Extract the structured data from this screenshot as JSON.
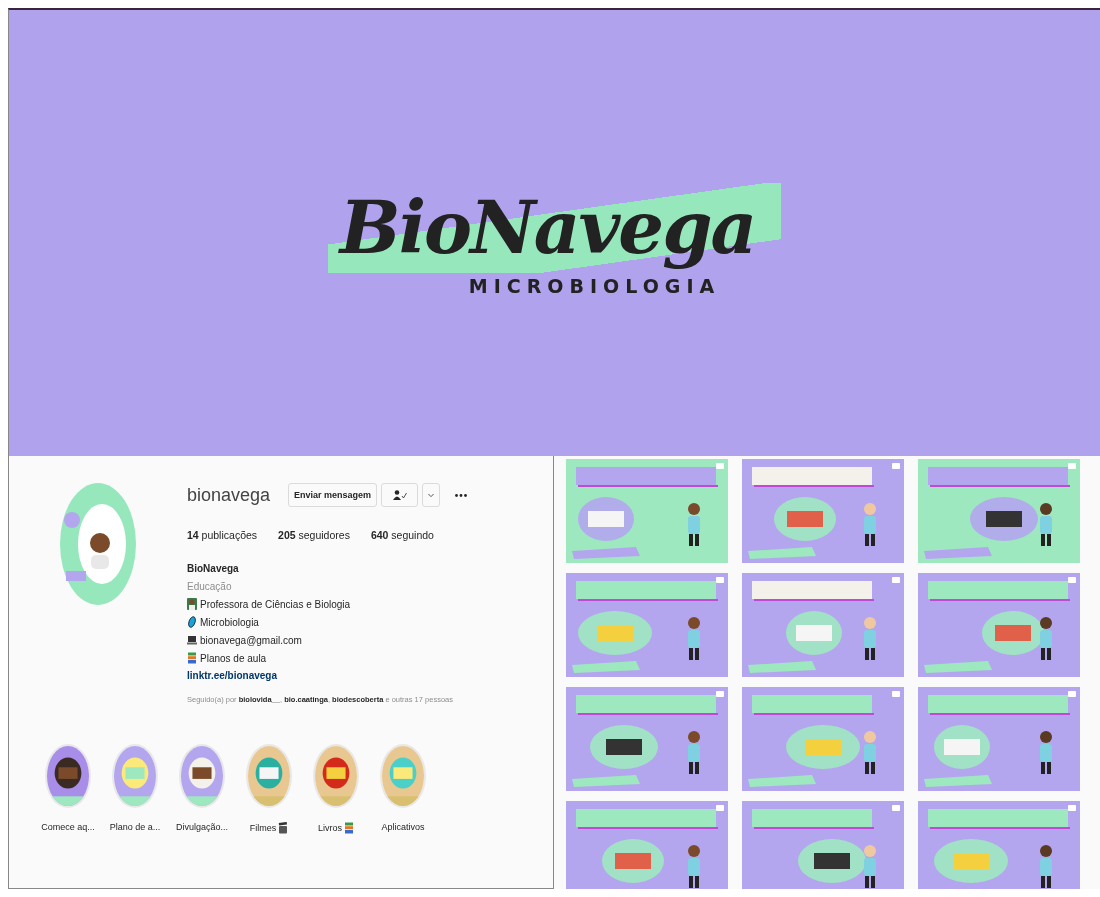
{
  "banner": {
    "logo": "BioNavega",
    "subtitle": "MICROBIOLOGIA"
  },
  "profile": {
    "username": "bionavega",
    "buttons": [
      {
        "kind": "text",
        "label": "Enviar mensagem"
      },
      {
        "kind": "follow"
      },
      {
        "kind": "chevron"
      },
      {
        "kind": "more"
      }
    ],
    "stats": [
      "**14** publicações",
      "**205** seguidores",
      "**640** seguindo"
    ],
    "name": "BioNavega",
    "category": "Educação",
    "bio": [
      {
        "text": "Professora de Ciências e Biologia"
      },
      {
        "text": "Microbiologia"
      },
      {
        "text": "bionavega@gmail.com"
      },
      {
        "text": "Planos de aula"
      }
    ],
    "link": "linktr.ee/bionavega",
    "followed_by": "Seguido(a) por **biolovida__**, **bio.caatinga**, **biodescoberta** e outras 17 pessoas"
  },
  "highlights": [
    {
      "label": "Comece aq...",
      "kind": "picture"
    },
    {
      "label": "Plano de a...",
      "kind": "picture"
    },
    {
      "label": "Divulgação...",
      "kind": "picture"
    },
    {
      "label": "Filmes",
      "kind": "picture"
    },
    {
      "label": "Livros",
      "kind": "picture"
    },
    {
      "label": "Aplicativos",
      "kind": "picture"
    }
  ]
}
